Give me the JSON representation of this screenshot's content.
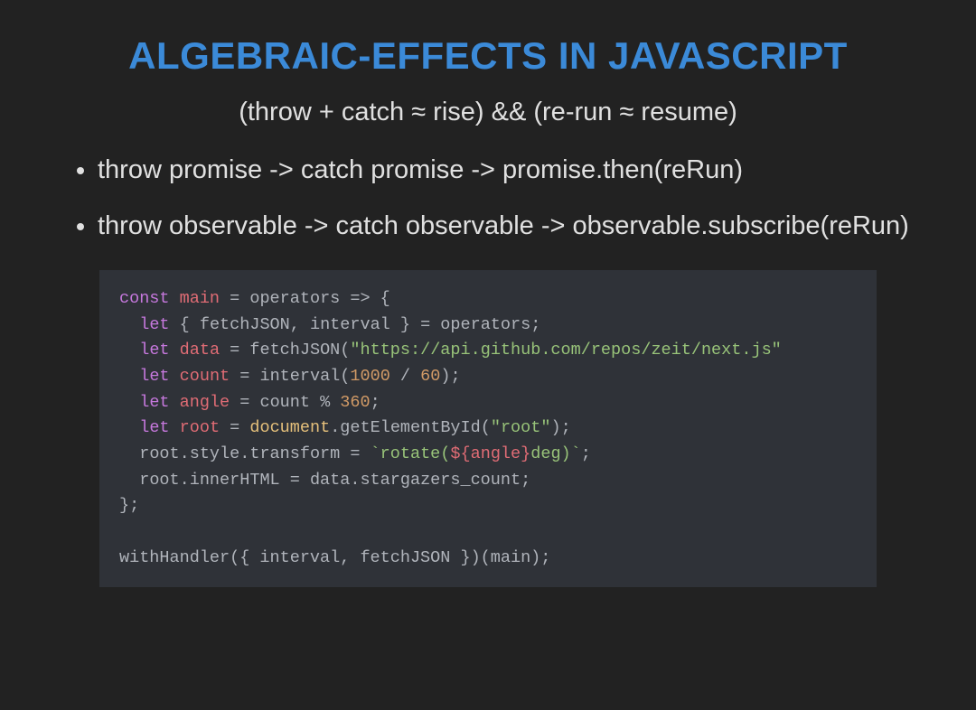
{
  "title": "ALGEBRAIC-EFFECTS IN JAVASCRIPT",
  "subtitle": "(throw + catch ≈ rise) && (re-run ≈ resume)",
  "bullets": [
    "throw promise -> catch promise -> promise.then(reRun)",
    "throw observable -> catch observable -> observable.subscribe(reRun)"
  ],
  "code": {
    "l1": {
      "kw": "const",
      "sp": " ",
      "id": "main",
      "rest": " = operators => {"
    },
    "l2": {
      "kw": "let",
      "sp": " ",
      "rest1": "{ fetchJSON, interval } = operators;"
    },
    "l3": {
      "kw": "let",
      "sp": " ",
      "id": "data",
      "rest": " = fetchJSON(",
      "str": "\"https://api.github.com/repos/zeit/next.js\""
    },
    "l4": {
      "kw": "let",
      "sp": " ",
      "id": "count",
      "rest": " = interval(",
      "num1": "1000",
      "mid": " / ",
      "num2": "60",
      "end": ");"
    },
    "l5": {
      "kw": "let",
      "sp": " ",
      "id": "angle",
      "rest": " = count % ",
      "num": "360",
      "end": ";"
    },
    "l6": {
      "kw": "let",
      "sp": " ",
      "id": "root",
      "eq": " = ",
      "obj": "document",
      "rest": ".getElementById(",
      "str": "\"root\"",
      "end": ");"
    },
    "l7": {
      "text": "root.style.transform = ",
      "tick": "`",
      "tmpl1": "rotate(",
      "dollar": "${",
      "tvar": "angle",
      "close": "}",
      "tmpl2": "deg)",
      "tick2": "`",
      "end": ";"
    },
    "l8": {
      "text": "root.innerHTML = data.stargazers_count;"
    },
    "l9": {
      "text": "};"
    },
    "l10": {
      "text": ""
    },
    "l11": {
      "text": "withHandler({ interval, fetchJSON })(main);"
    }
  }
}
